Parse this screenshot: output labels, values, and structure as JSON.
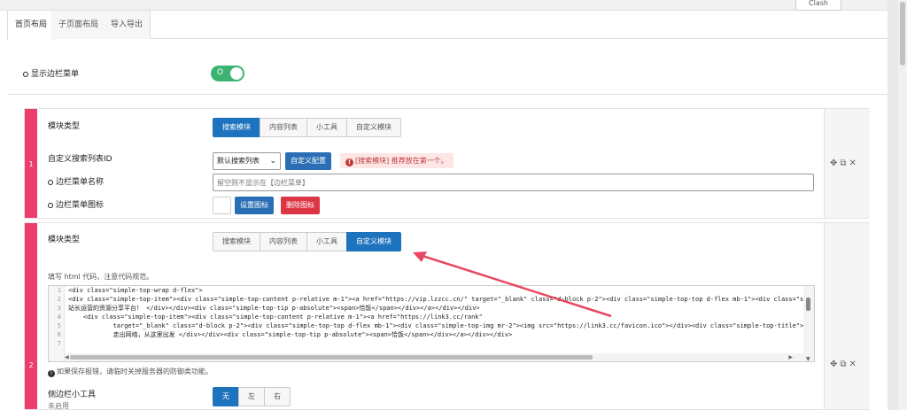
{
  "top_tab": {
    "label": "Clash"
  },
  "tabs": [
    {
      "label": "首页布局",
      "active": true
    },
    {
      "label": "子页面布局",
      "active": false
    },
    {
      "label": "导入导出",
      "active": false
    }
  ],
  "sidebar_toggle": {
    "label": "显示边栏菜单",
    "switch_glyph": "O",
    "enabled": true
  },
  "module1": {
    "index": "1",
    "type_label": "模块类型",
    "type_options": [
      {
        "label": "搜索模块",
        "selected": true
      },
      {
        "label": "内容列表",
        "selected": false
      },
      {
        "label": "小工具",
        "selected": false
      },
      {
        "label": "自定义模块",
        "selected": false
      }
    ],
    "search_id_label": "自定义搜索列表ID",
    "search_select_value": "默认搜索列表",
    "custom_config_button": "自定义配置",
    "alert_text": "[搜索模块] 推荐放在第一个。",
    "menu_name_label": "边栏菜单名称",
    "menu_name_placeholder": "留空则不显示在【边栏菜单】",
    "menu_icon_label": "边栏菜单图标",
    "set_icon_button": "设置图标",
    "delete_icon_button": "删除图标"
  },
  "module2": {
    "index": "2",
    "type_label": "模块类型",
    "type_options": [
      {
        "label": "搜索模块",
        "selected": false
      },
      {
        "label": "内容列表",
        "selected": false
      },
      {
        "label": "小工具",
        "selected": false
      },
      {
        "label": "自定义模块",
        "selected": true
      }
    ],
    "editor_hint": "填写 html 代码，注意代码规范。",
    "line_numbers": [
      "1",
      "2",
      "3",
      "4",
      "5",
      "6",
      "7"
    ],
    "code_lines": [
      "<div class=\"simple-top-wrap d-flex\">",
      "<div class=\"simple-top-item\"><div class=\"simple-top-content p-relative m-1\"><a href=\"https://vip.lzzcc.cn/\" target=\"_blank\" class=\"d-block p-2\"><div class=\"simple-top-top d-flex mb-1\"><div class=\"si",
      "站长运营的资源分享平台！ </div></div><div class=\"simple-top-tip p-absolute\"><span>恰饭</span></div></a></div></div>",
      "    <div class=\"simple-top-item\"><div class=\"simple-top-content p-relative m-1\"><a href=\"https://link3.cc/rank\"",
      "            target=\"_blank\" class=\"d-block p-2\"><div class=\"simple-top-top d-flex mb-1\"><div class=\"simple-top-img mr-2\"><img src=\"https://link3.cc/favicon.ico\"></div><div class=\"simple-top-title\">",
      "            走出网络，从这里出发 </div></div><div class=\"simple-top-tip p-absolute\"><span>恰饭</span></div></a></div></div>",
      ""
    ],
    "save_note": "如果保存报错，请临时关掉服务器的防御类功能。",
    "side_tools_label": "侧边栏小工具",
    "side_tools_sub": "未启用",
    "side_tools_options": [
      {
        "label": "无",
        "selected": true
      },
      {
        "label": "左",
        "selected": false
      },
      {
        "label": "右",
        "selected": false
      }
    ]
  },
  "colors": {
    "accent": "#1e73be",
    "pink": "#ec3d6b",
    "switch_on": "#3cb371",
    "danger": "#dc3545",
    "annotation_arrow": "#e8475f"
  },
  "icons": [
    "move-icon",
    "copy-icon",
    "close-icon"
  ]
}
